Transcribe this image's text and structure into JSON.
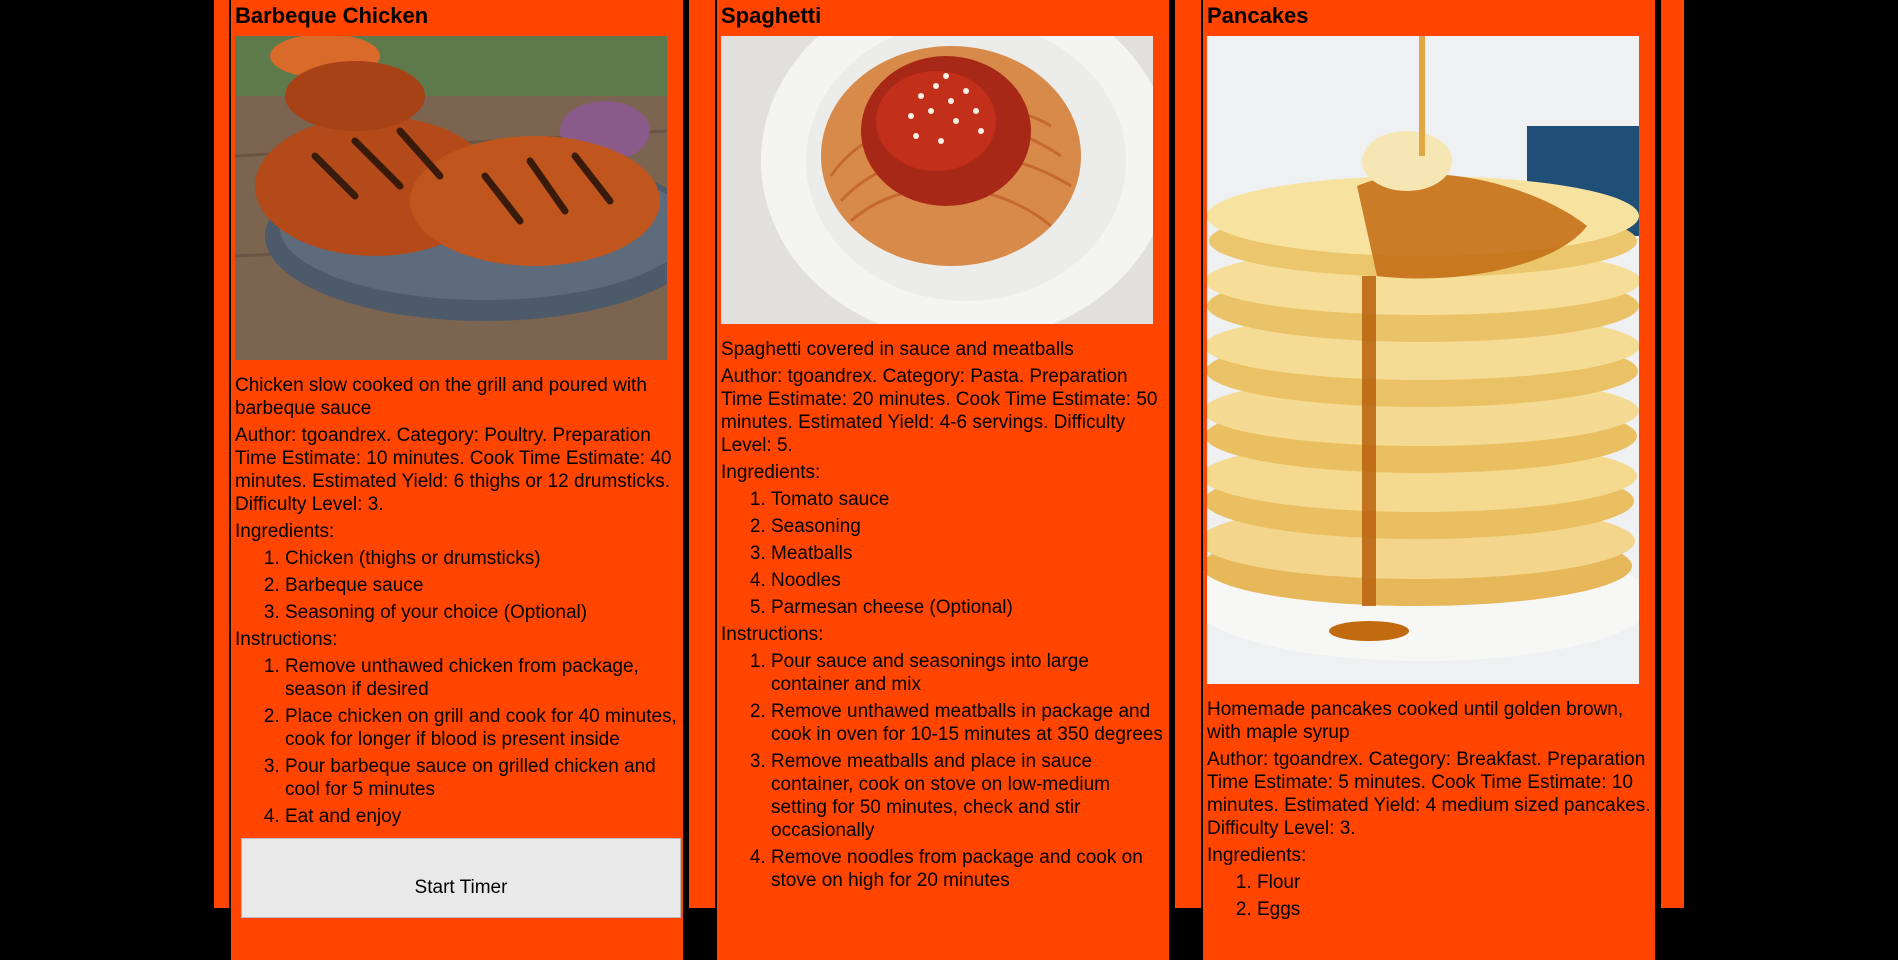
{
  "recipes": [
    {
      "title": "Barbeque Chicken",
      "image_alt": "Grilled barbeque chicken on a plate",
      "description": "Chicken slow cooked on the grill and poured with barbeque sauce",
      "meta": "Author: tgoandrex. Category: Poultry. Preparation Time Estimate: 10 minutes. Cook Time Estimate: 40 minutes. Estimated Yield: 6 thighs or 12 drumsticks. Difficulty Level: 3.",
      "ingredients_label": "Ingredients:",
      "ingredients": [
        "Chicken (thighs or drumsticks)",
        "Barbeque sauce",
        "Seasoning of your choice (Optional)"
      ],
      "instructions_label": "Instructions:",
      "instructions": [
        "Remove unthawed chicken from package, season if desired",
        "Place chicken on grill and cook for 40 minutes, cook for longer if blood is present inside",
        "Pour barbeque sauce on grilled chicken and cool for 5 minutes",
        "Eat and enjoy"
      ],
      "button_label": "Start Timer"
    },
    {
      "title": "Spaghetti",
      "image_alt": "Spaghetti with tomato sauce and parmesan in a white bowl",
      "description": "Spaghetti covered in sauce and meatballs",
      "meta": "Author: tgoandrex. Category: Pasta. Preparation Time Estimate: 20 minutes. Cook Time Estimate: 50 minutes. Estimated Yield: 4-6 servings. Difficulty Level: 5.",
      "ingredients_label": "Ingredients:",
      "ingredients": [
        "Tomato sauce",
        "Seasoning",
        "Meatballs",
        "Noodles",
        "Parmesan cheese (Optional)"
      ],
      "instructions_label": "Instructions:",
      "instructions": [
        "Pour sauce and seasonings into large container and mix",
        "Remove unthawed meatballs in package and cook in oven for 10-15 minutes at 350 degrees",
        "Remove meatballs and place in sauce container, cook on stove on low-medium setting for 50 minutes, check and stir occasionally",
        "Remove noodles from package and cook on stove on high for 20 minutes"
      ]
    },
    {
      "title": "Pancakes",
      "image_alt": "Stack of pancakes with butter and maple syrup",
      "description": "Homemade pancakes cooked until golden brown, with maple syrup",
      "meta": "Author: tgoandrex. Category: Breakfast. Preparation Time Estimate: 5 minutes. Cook Time Estimate: 10 minutes. Estimated Yield: 4 medium sized pancakes. Difficulty Level: 3.",
      "ingredients_label": "Ingredients:",
      "ingredients": [
        "Flour",
        "Eggs"
      ]
    }
  ]
}
